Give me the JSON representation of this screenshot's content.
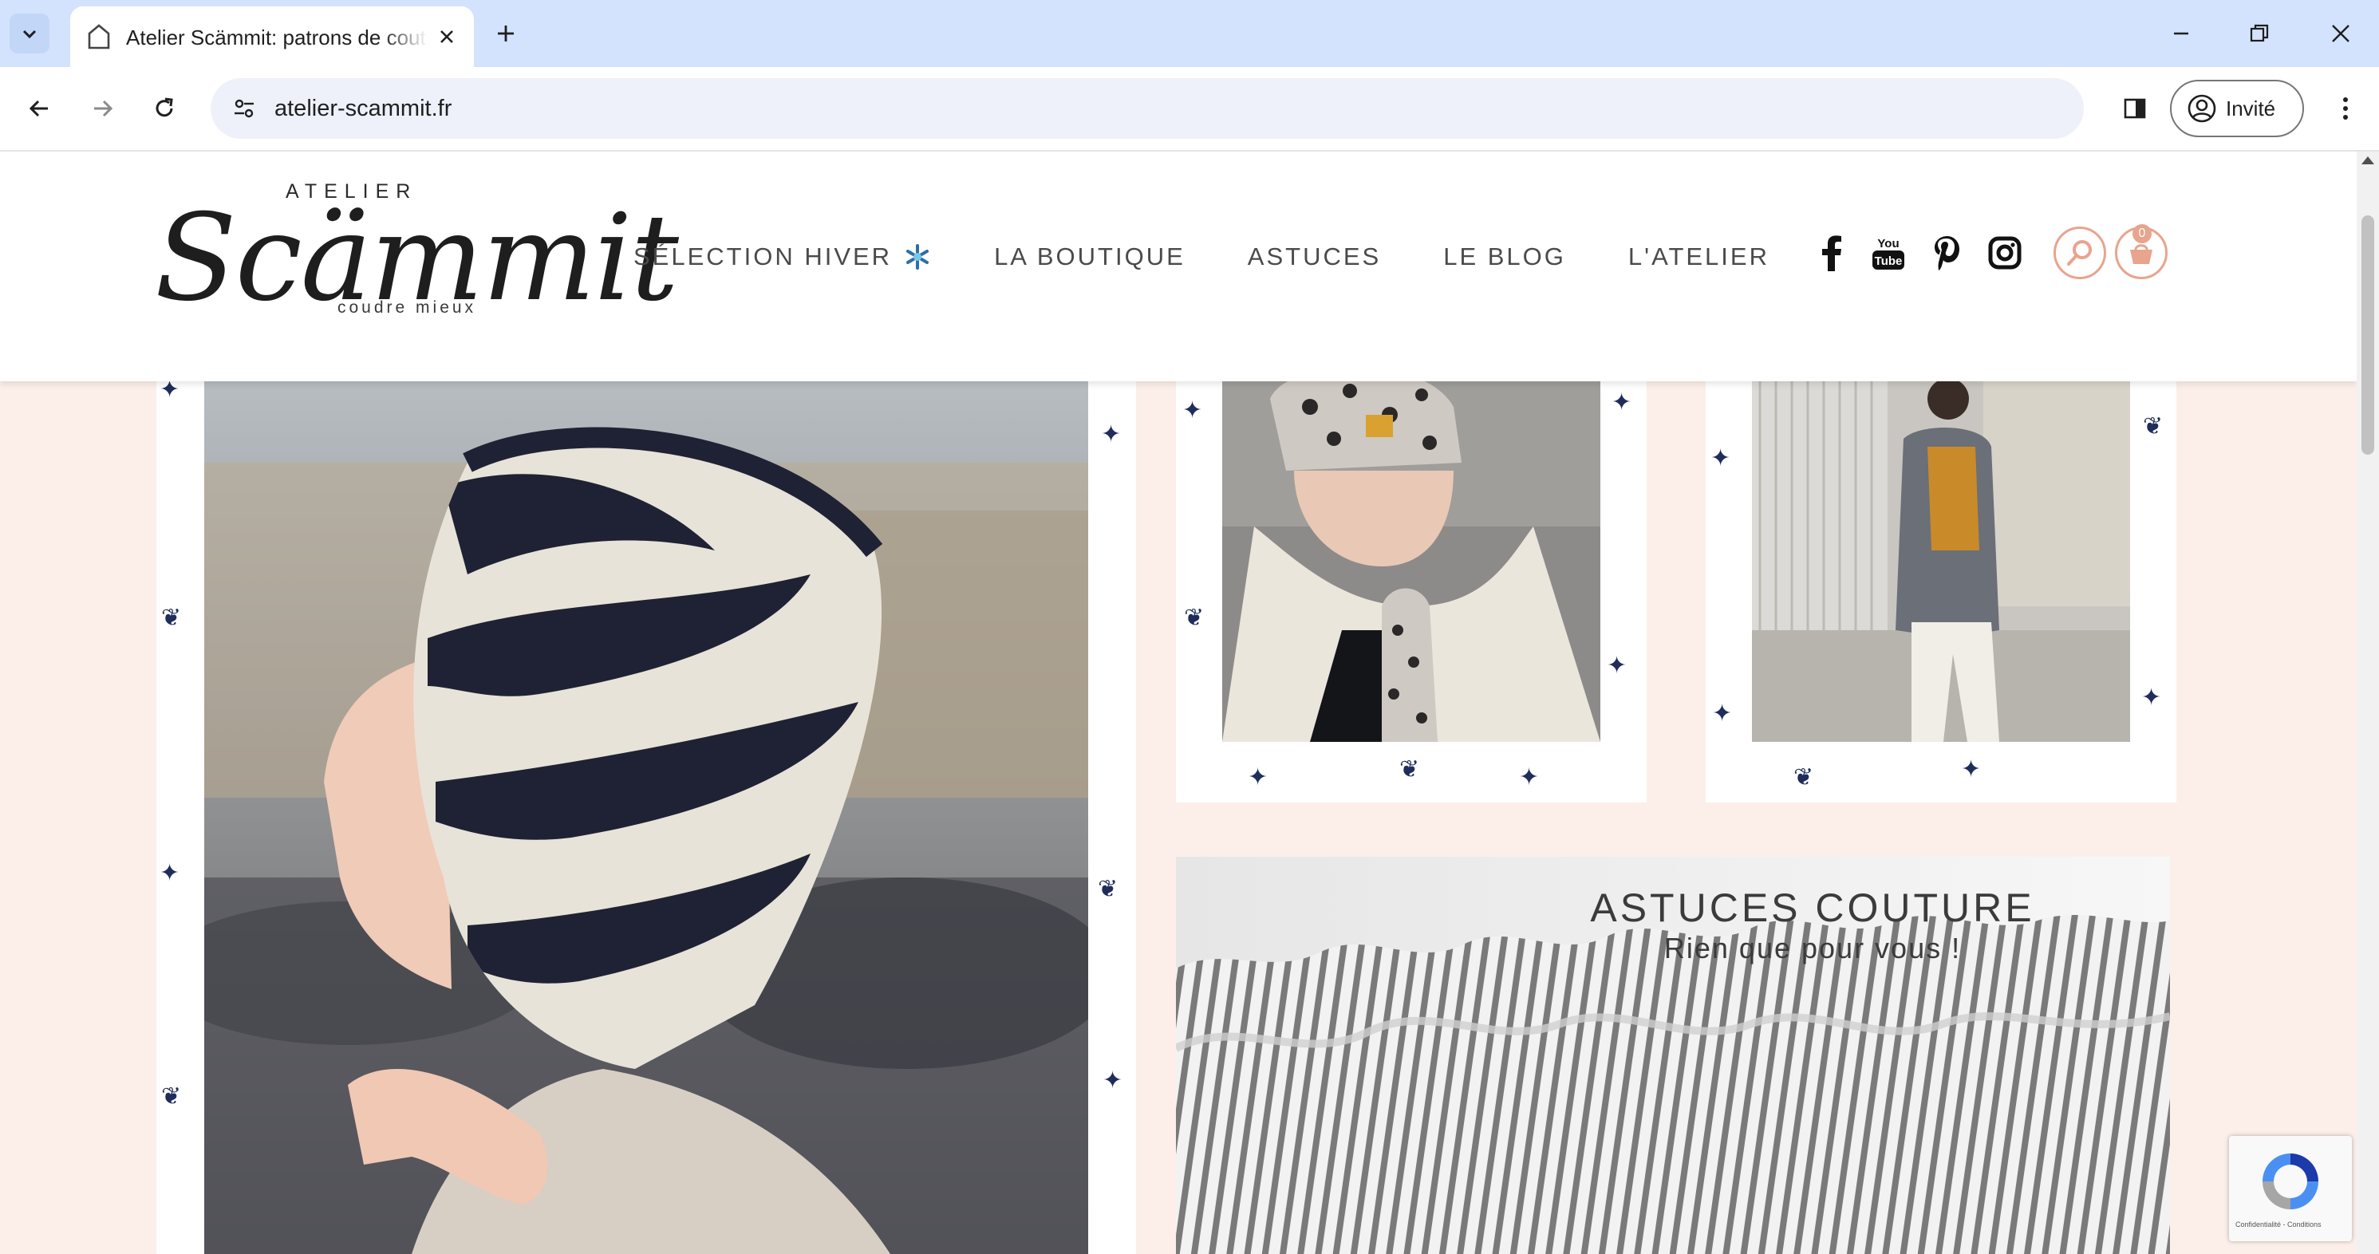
{
  "browser": {
    "tab_title": "Atelier Scämmit: patrons de couture",
    "url": "atelier-scammit.fr",
    "profile_label": "Invité"
  },
  "site": {
    "logo": {
      "small": "ATELIER",
      "main": "Scämmit",
      "tagline": "coudre mieux"
    },
    "nav": [
      {
        "label": "SÉLECTION HIVER"
      },
      {
        "label": "LA BOUTIQUE"
      },
      {
        "label": "ASTUCES"
      },
      {
        "label": "LE BLOG"
      },
      {
        "label": "L'ATELIER"
      }
    ],
    "social_icons": [
      "facebook-icon",
      "youtube-icon",
      "pinterest-icon",
      "instagram-icon"
    ],
    "cart_count": "0",
    "accent_color": "#e8a48d"
  },
  "content": {
    "astuces_banner": {
      "title": "ASTUCES COUTURE",
      "subtitle": "Rien que pour vous !"
    }
  },
  "recaptcha": {
    "legal": "Confidentialité - Conditions"
  }
}
